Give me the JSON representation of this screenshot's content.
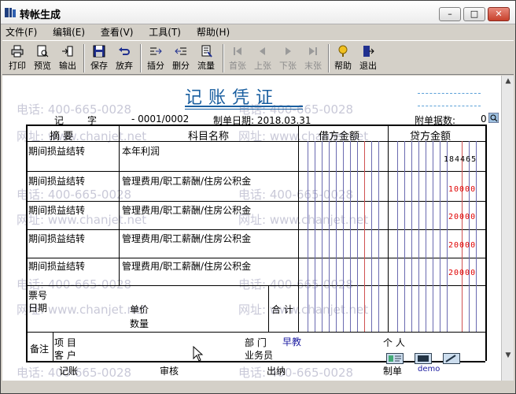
{
  "window": {
    "title": "转帐生成",
    "min_label": "–",
    "max_label": "□",
    "close_label": "✕"
  },
  "menu": [
    "文件(F)",
    "编辑(E)",
    "查看(V)",
    "工具(T)",
    "帮助(H)"
  ],
  "toolbar": [
    {
      "label": "打印",
      "icon": "printer-icon",
      "enabled": true
    },
    {
      "label": "预览",
      "icon": "preview-icon",
      "enabled": true
    },
    {
      "label": "输出",
      "icon": "export-icon",
      "enabled": true
    },
    {
      "label": "保存",
      "icon": "save-icon",
      "enabled": true
    },
    {
      "label": "放弃",
      "icon": "undo-icon",
      "enabled": true
    },
    {
      "label": "插分",
      "icon": "insert-row-icon",
      "enabled": true
    },
    {
      "label": "删分",
      "icon": "delete-row-icon",
      "enabled": true
    },
    {
      "label": "流量",
      "icon": "cashflow-icon",
      "enabled": true
    },
    {
      "label": "首张",
      "icon": "first-icon",
      "enabled": false
    },
    {
      "label": "上张",
      "icon": "prev-icon",
      "enabled": false
    },
    {
      "label": "下张",
      "icon": "next-icon",
      "enabled": false
    },
    {
      "label": "末张",
      "icon": "last-icon",
      "enabled": false
    },
    {
      "label": "帮助",
      "icon": "help-icon",
      "enabled": true
    },
    {
      "label": "退出",
      "icon": "exit-icon",
      "enabled": true
    }
  ],
  "watermark": {
    "phone": "电话: 400-665-0028",
    "site": "网址: www.chanjet.net"
  },
  "voucher": {
    "title": "记账凭证",
    "type_label": "记",
    "type_char": "字",
    "number": "- 0001/0002",
    "date_label": "制单日期: 2018.03.31",
    "attach_label": "附单据数:",
    "attach_value": "0",
    "headers": {
      "summary": "摘 要",
      "account": "科目名称",
      "debit": "借方金额",
      "credit": "贷方金额"
    },
    "rows": [
      {
        "summary": "期间损益结转",
        "account": "本年利润",
        "credit": "184465",
        "credit_color": "#000000"
      },
      {
        "summary": "期间损益结转",
        "account": "管理费用/职工薪酬/住房公积金",
        "credit": "10000",
        "credit_color": "#e00000"
      },
      {
        "summary": "期间损益结转",
        "account": "管理费用/职工薪酬/住房公积金",
        "credit": "20000",
        "credit_color": "#e00000"
      },
      {
        "summary": "期间损益结转",
        "account": "管理费用/职工薪酬/住房公积金",
        "credit": "20000",
        "credit_color": "#e00000"
      },
      {
        "summary": "期间损益结转",
        "account": "管理费用/职工薪酬/住房公积金",
        "credit": "20000",
        "credit_color": "#e00000"
      }
    ],
    "bill_no_label": "票号",
    "date_label2": "日期",
    "unit_price_label": "单价",
    "quantity_label": "数量",
    "total_label": "合 计",
    "remark_label": "备注",
    "project_label": "项  目",
    "customer_label": "客  户",
    "department_label": "部  门",
    "department_value": "早教",
    "clerk_label": "业务员",
    "person_label": "个  人",
    "bookkeeper_label": "记账",
    "auditor_label": "审核",
    "cashier_label": "出纳",
    "preparer_label": "制单",
    "preparer_value": "demo"
  }
}
